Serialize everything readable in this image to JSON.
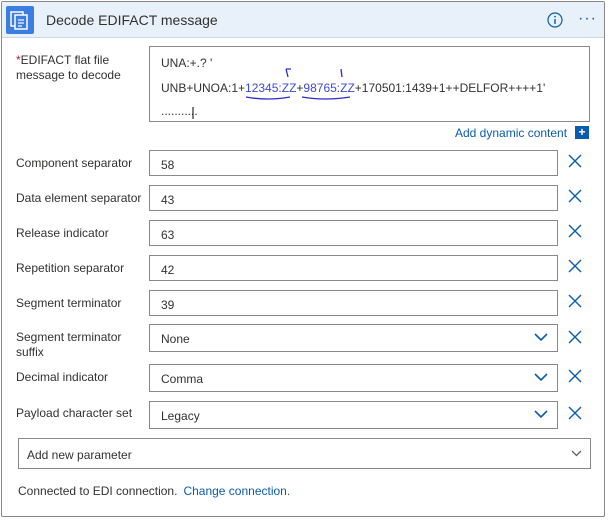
{
  "header": {
    "title": "Decode EDIFACT message"
  },
  "message": {
    "label": "EDIFACT flat file message to decode",
    "label_line1": "EDIFACT flat file",
    "label_line2": "message to decode",
    "required_marker": "*",
    "line1": "UNA:+.? '",
    "line2_prefix": "UNB+UNOA:1+",
    "line2_sender": "12345:ZZ",
    "line2_sep": "+",
    "line2_receiver": "98765:ZZ",
    "line2_suffix": "+170501:1439+1++DELFOR++++1'",
    "line3": "..........."
  },
  "dynamic_content": {
    "label": "Add dynamic content",
    "plus": "+"
  },
  "fields": [
    {
      "label": "Component separator",
      "value": "58"
    },
    {
      "label": "Data element separator",
      "value": "43"
    },
    {
      "label": "Release indicator",
      "value": "63"
    },
    {
      "label": "Repetition separator",
      "value": "42"
    },
    {
      "label": "Segment terminator",
      "value": "39"
    },
    {
      "label_line1": "Segment terminator",
      "label_line2": "suffix",
      "value": "None"
    },
    {
      "label": "Decimal indicator",
      "value": "Comma"
    },
    {
      "label": "Payload character set",
      "value": "Legacy"
    }
  ],
  "add_parameter": {
    "label": "Add new parameter"
  },
  "footer": {
    "connected_text": "Connected to EDI connection.",
    "change_link": "Change connection."
  },
  "colors": {
    "accent": "#0b5cad",
    "header_bg": "#e8f1fa",
    "app_icon": "#3b7de0",
    "required": "#a4262c"
  },
  "icons": [
    "app-document-icon",
    "info-icon",
    "more-icon",
    "close-icon",
    "chevron-down-icon"
  ]
}
